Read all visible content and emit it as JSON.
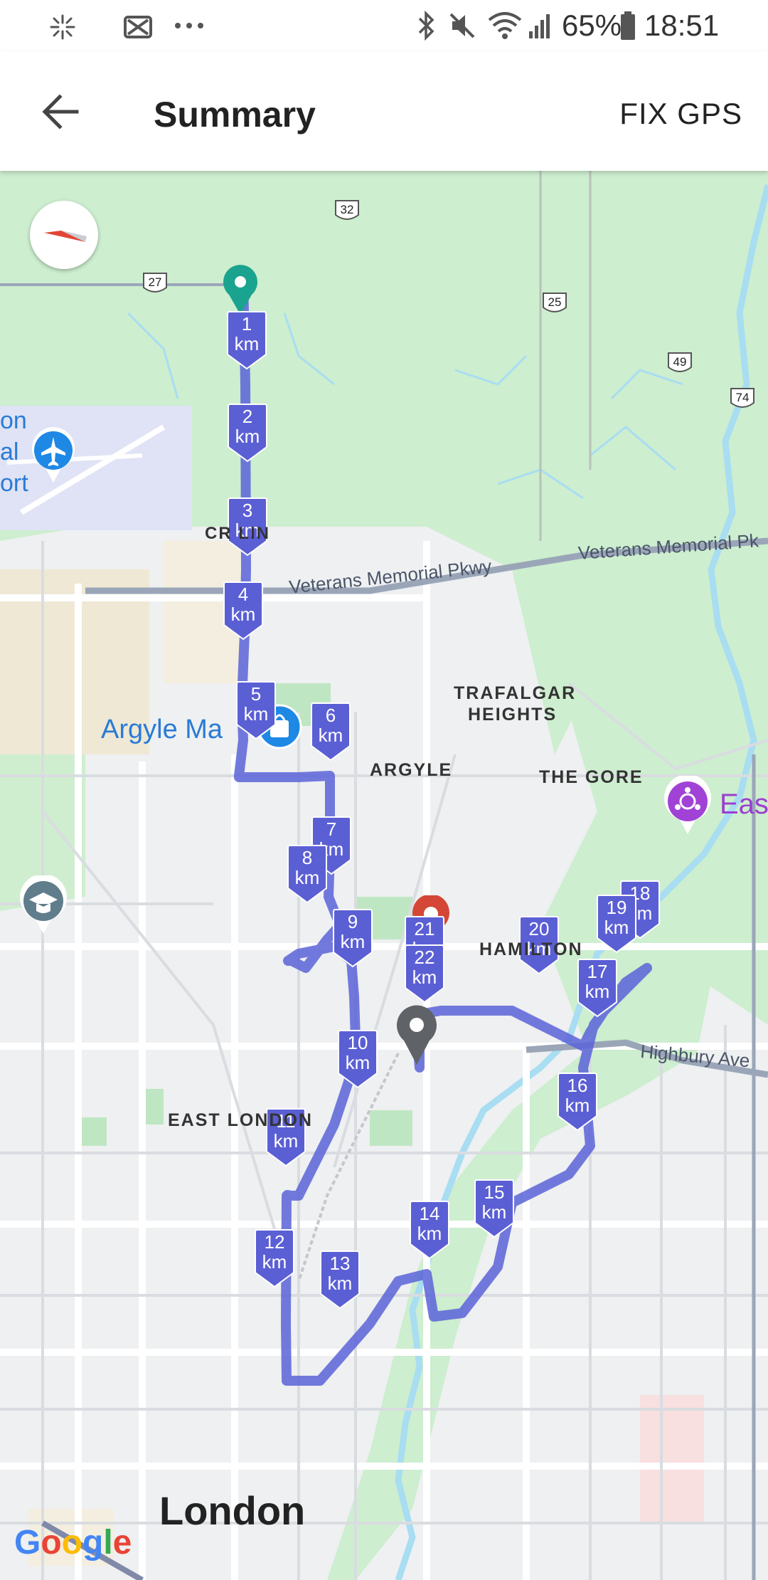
{
  "status_bar": {
    "battery_percent": "65%",
    "time": "18:51",
    "left_icons": [
      "pinwheel-icon",
      "app-icon",
      "more-dots-icon"
    ],
    "right_icons": [
      "bluetooth-icon",
      "mute-icon",
      "wifi-icon",
      "signal-icon",
      "battery-icon"
    ]
  },
  "app_bar": {
    "title": "Summary",
    "action_label": "FIX GPS",
    "back_icon": "back-arrow-icon"
  },
  "map": {
    "place_labels": {
      "crumlin": "CR    LIN",
      "veterans_1": "Veterans Memorial Pkwy",
      "veterans_2": "Veterans Memorial Pk",
      "trafalgar_1": "TRAFALGAR",
      "trafalgar_2": "HEIGHTS",
      "argyle": "ARGYLE",
      "the_gore": "THE GORE",
      "argyle_mall": "Argyle Ma",
      "hamilton": "HAMILTON",
      "highbury": "Highbury Ave",
      "east_london": "EAST LONDON",
      "london": "London",
      "east_partial": "Eas",
      "airport_1": "on",
      "airport_2": "al",
      "airport_3": "ort"
    },
    "highway_shields": [
      "32",
      "27",
      "25",
      "49",
      "74"
    ],
    "km_unit": "km",
    "km_markers": [
      "1",
      "2",
      "3",
      "4",
      "5",
      "6",
      "7",
      "8",
      "9",
      "10",
      "11",
      "12",
      "13",
      "14",
      "15",
      "16",
      "17",
      "18",
      "19",
      "20",
      "21",
      "22"
    ],
    "route_color": "#5a63d8",
    "marker_color": "#5b5fd4",
    "start_pin_color": "#1aa38f",
    "end_pin_color": "#d44636",
    "current_pin_color": "#5f6368",
    "logo_text": "Google"
  }
}
